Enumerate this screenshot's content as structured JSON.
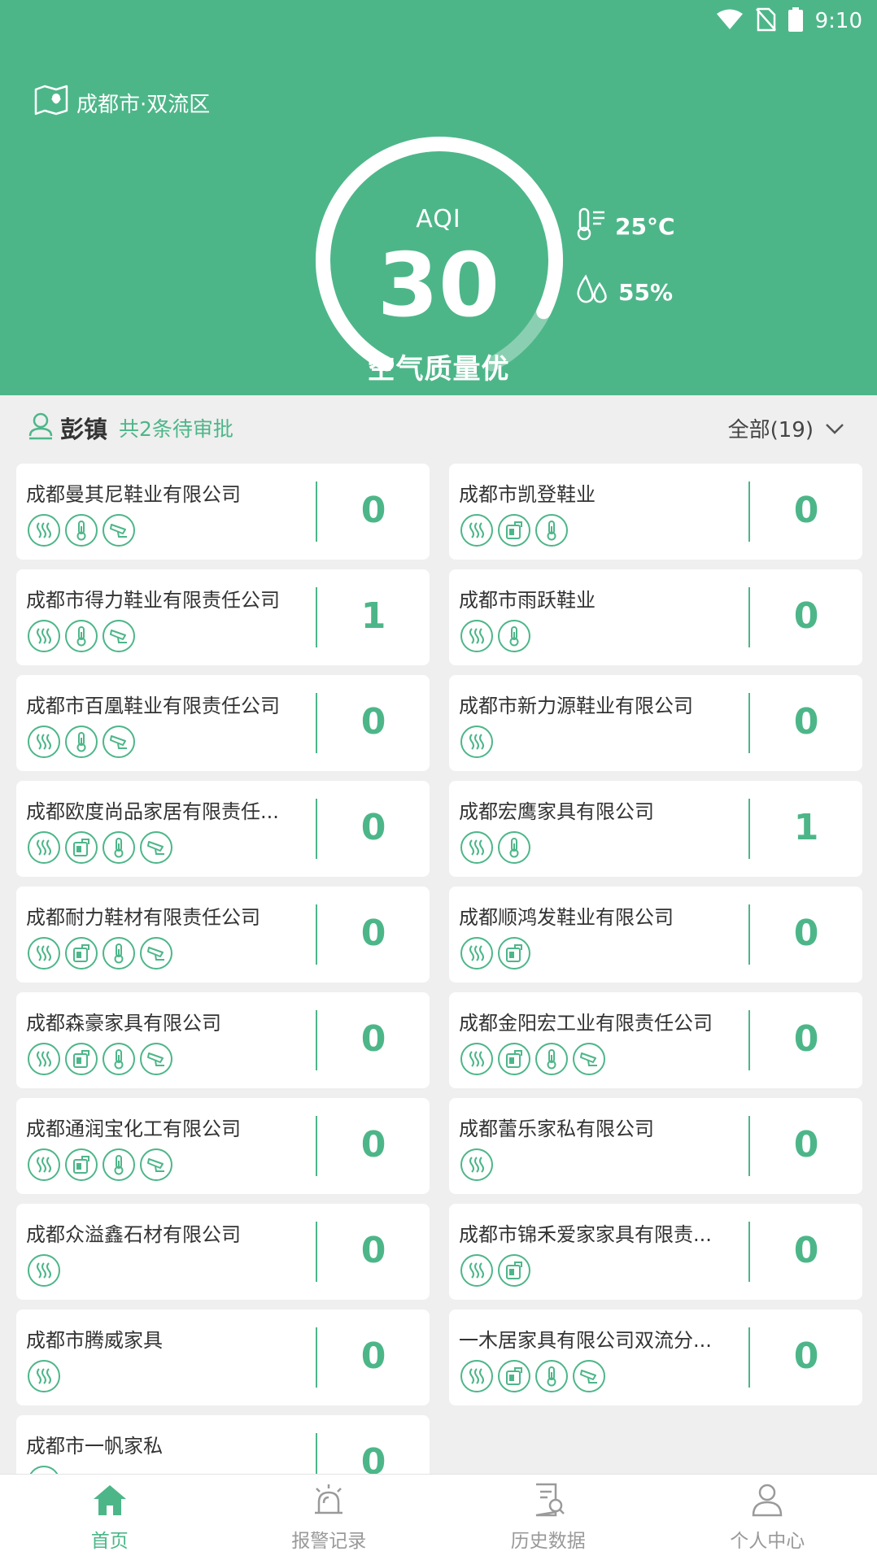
{
  "status_bar": {
    "time": "9:10"
  },
  "location": {
    "label": "成都市·双流区"
  },
  "aqi": {
    "label": "AQI",
    "value": 30,
    "display": "30",
    "status": "空气质量优",
    "gauge_fraction": 0.88
  },
  "weather": {
    "temperature": "25°C",
    "humidity": "55%"
  },
  "section": {
    "town": "彭镇",
    "pending": "共2条待审批",
    "filter": "全部(19)"
  },
  "colors": {
    "primary": "#4db689",
    "background": "#efefef"
  },
  "companies": [
    {
      "name": "成都曼其尼鞋业有限公司",
      "count": "0",
      "icons": [
        "exhaust-icon",
        "thermometer-icon",
        "camera-icon"
      ]
    },
    {
      "name": "成都市凯登鞋业",
      "count": "0",
      "icons": [
        "exhaust-icon",
        "meter-icon",
        "thermometer-icon"
      ]
    },
    {
      "name": "成都市得力鞋业有限责任公司",
      "count": "1",
      "icons": [
        "exhaust-icon",
        "thermometer-icon",
        "camera-icon"
      ]
    },
    {
      "name": "成都市雨跃鞋业",
      "count": "0",
      "icons": [
        "exhaust-icon",
        "thermometer-icon"
      ]
    },
    {
      "name": "成都市百凰鞋业有限责任公司",
      "count": "0",
      "icons": [
        "exhaust-icon",
        "thermometer-icon",
        "camera-icon"
      ]
    },
    {
      "name": "成都市新力源鞋业有限公司",
      "count": "0",
      "icons": [
        "exhaust-icon"
      ]
    },
    {
      "name": "成都欧度尚品家居有限责任...",
      "count": "0",
      "icons": [
        "exhaust-icon",
        "meter-icon",
        "thermometer-icon",
        "camera-icon"
      ]
    },
    {
      "name": "成都宏鹰家具有限公司",
      "count": "1",
      "icons": [
        "exhaust-icon",
        "thermometer-icon"
      ]
    },
    {
      "name": "成都耐力鞋材有限责任公司",
      "count": "0",
      "icons": [
        "exhaust-icon",
        "meter-icon",
        "thermometer-icon",
        "camera-icon"
      ]
    },
    {
      "name": "成都顺鸿发鞋业有限公司",
      "count": "0",
      "icons": [
        "exhaust-icon",
        "meter-icon"
      ]
    },
    {
      "name": "成都森豪家具有限公司",
      "count": "0",
      "icons": [
        "exhaust-icon",
        "meter-icon",
        "thermometer-icon",
        "camera-icon"
      ]
    },
    {
      "name": "成都金阳宏工业有限责任公司",
      "count": "0",
      "icons": [
        "exhaust-icon",
        "meter-icon",
        "thermometer-icon",
        "camera-icon"
      ]
    },
    {
      "name": "成都通润宝化工有限公司",
      "count": "0",
      "icons": [
        "exhaust-icon",
        "meter-icon",
        "thermometer-icon",
        "camera-icon"
      ]
    },
    {
      "name": "成都蕾乐家私有限公司",
      "count": "0",
      "icons": [
        "exhaust-icon"
      ]
    },
    {
      "name": "成都众溢鑫石材有限公司",
      "count": "0",
      "icons": [
        "exhaust-icon"
      ]
    },
    {
      "name": "成都市锦禾爱家家具有限责...",
      "count": "0",
      "icons": [
        "exhaust-icon",
        "meter-icon"
      ]
    },
    {
      "name": "成都市腾威家具",
      "count": "0",
      "icons": [
        "exhaust-icon"
      ]
    },
    {
      "name": "一木居家具有限公司双流分...",
      "count": "0",
      "icons": [
        "exhaust-icon",
        "meter-icon",
        "thermometer-icon",
        "camera-icon"
      ]
    },
    {
      "name": "成都市一帆家私",
      "count": "0",
      "icons": [
        "exhaust-icon"
      ]
    }
  ],
  "nav": [
    {
      "label": "首页",
      "icon": "home-icon",
      "active": true
    },
    {
      "label": "报警记录",
      "icon": "alarm-icon",
      "active": false
    },
    {
      "label": "历史数据",
      "icon": "history-icon",
      "active": false
    },
    {
      "label": "个人中心",
      "icon": "user-icon",
      "active": false
    }
  ]
}
